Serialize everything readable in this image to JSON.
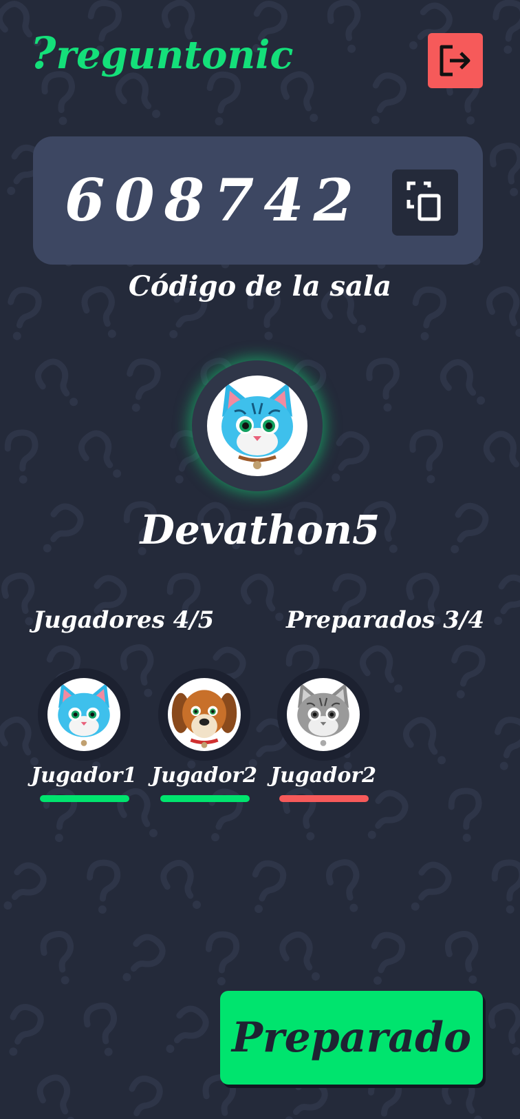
{
  "app": {
    "logo_mark": "?",
    "logo_text": "reguntonic"
  },
  "header": {
    "exit_icon": "logout-icon"
  },
  "room": {
    "code_digits": [
      "6",
      "0",
      "8",
      "7",
      "4",
      "2"
    ],
    "copy_icon": "copy-icon",
    "code_label": "Código de la sala"
  },
  "user": {
    "name": "Devathon5",
    "avatar": "blue-cat-avatar"
  },
  "lobby": {
    "players_label": "Jugadores 4/5",
    "ready_label": "Preparados 3/4",
    "players": [
      {
        "name": "Jugador1",
        "avatar": "blue-cat-avatar",
        "ready": true
      },
      {
        "name": "Jugador2",
        "avatar": "brown-dog-avatar",
        "ready": true
      },
      {
        "name": "Jugador2",
        "avatar": "gray-cat-avatar",
        "ready": false
      }
    ]
  },
  "colors": {
    "background": "#242a3a",
    "accent": "#00e46e",
    "danger": "#f65a5a",
    "card": "#3d4762"
  },
  "actions": {
    "ready_button": "Preparado"
  }
}
